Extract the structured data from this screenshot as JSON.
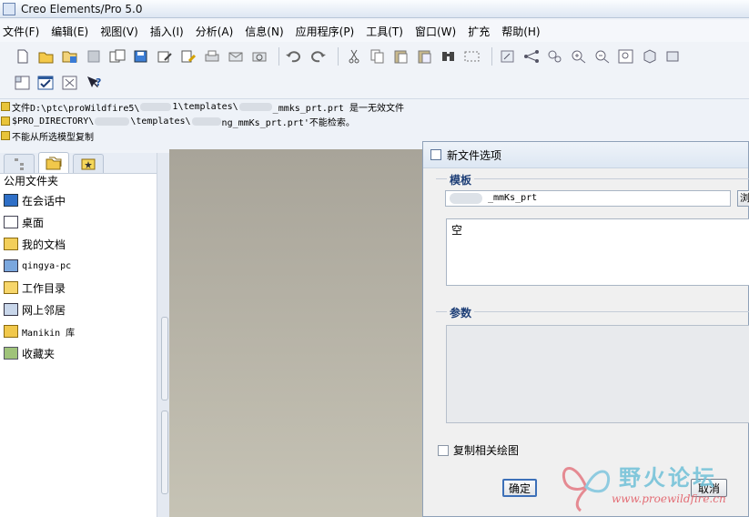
{
  "window": {
    "title": "Creo Elements/Pro 5.0"
  },
  "menu": {
    "items": [
      "文件(F)",
      "编辑(E)",
      "视图(V)",
      "插入(I)",
      "分析(A)",
      "信息(N)",
      "应用程序(P)",
      "工具(T)",
      "窗口(W)",
      "扩充",
      "帮助(H)"
    ]
  },
  "toolbar_row1": [
    {
      "icon": "new-file-icon"
    },
    {
      "icon": "open-folder-icon"
    },
    {
      "icon": "open-session-icon"
    },
    {
      "icon": "save-icon"
    },
    {
      "icon": "save-copy-icon"
    },
    {
      "icon": "backup-icon"
    },
    {
      "icon": "rename-icon"
    },
    {
      "icon": "erase-icon"
    },
    {
      "icon": "print-icon"
    },
    {
      "icon": "email-icon"
    },
    {
      "icon": "email-link-icon"
    },
    {
      "icon": "undo-icon"
    },
    {
      "icon": "redo-icon"
    },
    {
      "icon": "cut-icon"
    },
    {
      "icon": "copy-icon"
    },
    {
      "icon": "paste-icon"
    },
    {
      "icon": "paste-special-icon"
    },
    {
      "icon": "find-icon"
    },
    {
      "icon": "select-box-icon"
    },
    {
      "icon": "regenerate-icon"
    },
    {
      "icon": "datum-display-icon"
    },
    {
      "icon": "model-tree-icon"
    },
    {
      "icon": "zoom-in-icon"
    },
    {
      "icon": "zoom-out-icon"
    },
    {
      "icon": "refit-icon"
    },
    {
      "icon": "orient-icon"
    },
    {
      "icon": "view-manager-icon"
    }
  ],
  "toolbar_row2": [
    {
      "icon": "window-layout-icon"
    },
    {
      "icon": "checked-window-icon"
    },
    {
      "icon": "close-window-icon"
    },
    {
      "icon": "context-help-icon"
    }
  ],
  "messages": [
    {
      "prefix": "文件D:\\ptc\\proWildfire5\\",
      "suffix": "1\\templates\\",
      "tail": "_mmks_prt.prt 是一无效文件"
    },
    {
      "prefix": " $PRO_DIRECTORY\\",
      "suffix": "\\templates\\",
      "tail": "ng_mmKs_prt.prt'不能检索。"
    },
    {
      "prefix": "不能从所选模型复制",
      "suffix": "",
      "tail": ""
    }
  ],
  "navigator": {
    "header": "公用文件夹",
    "items": [
      {
        "label": "在会话中",
        "icon": "session-icon"
      },
      {
        "label": "桌面",
        "icon": "desktop-icon"
      },
      {
        "label": "我的文档",
        "icon": "documents-folder-icon"
      },
      {
        "label": "qingya-pc",
        "icon": "computer-icon"
      },
      {
        "label": "工作目录",
        "icon": "working-directory-icon"
      },
      {
        "label": "网上邻居",
        "icon": "network-icon"
      },
      {
        "label": "Manikin 库",
        "icon": "library-icon"
      },
      {
        "label": "收藏夹",
        "icon": "favorites-icon"
      }
    ]
  },
  "dialog": {
    "title": "新文件选项",
    "template_group": "模板",
    "template_value": "_mmKs_prt",
    "browse_label": "浏",
    "template_list": [
      "空"
    ],
    "params_group": "参数",
    "copy_drawings_label": "复制相关绘图",
    "ok_label": "确定",
    "cancel_label": "取消"
  },
  "watermark": {
    "text": "野火论坛",
    "url": "www.proewildfire.cn"
  }
}
